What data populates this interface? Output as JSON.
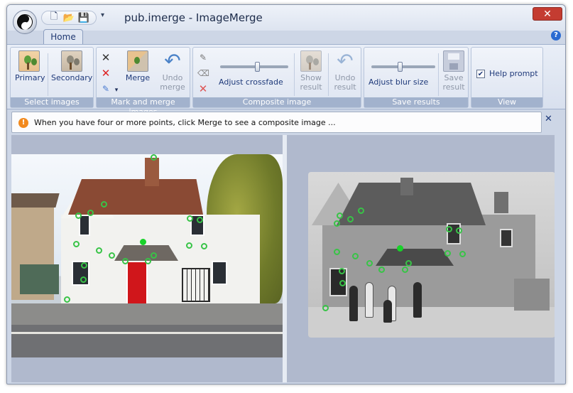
{
  "window": {
    "title": "pub.imerge - ImageMerge",
    "close_label": "✕"
  },
  "qat": {
    "icons": [
      "new-document-icon",
      "open-folder-icon",
      "save-disk-icon"
    ],
    "customize_label": "▾"
  },
  "tabs": [
    {
      "label": "Home",
      "selected": true
    }
  ],
  "help_label": "?",
  "ribbon": {
    "groups": [
      {
        "label": "Select images"
      },
      {
        "label": "Mark and merge images"
      },
      {
        "label": "Composite image"
      },
      {
        "label": "Save results"
      },
      {
        "label": "View"
      }
    ],
    "select_images": {
      "primary_label": "Primary",
      "secondary_label": "Secondary"
    },
    "mark_merge": {
      "merge_label": "Merge",
      "undo_merge_label": "Undo merge",
      "undo_merge_enabled": false
    },
    "composite": {
      "crossfade_label": "Adjust crossfade",
      "crossfade_value": 0.55,
      "show_result_label": "Show result",
      "show_result_enabled": false,
      "undo_result_label": "Undo result",
      "undo_result_enabled": false
    },
    "save_results": {
      "blur_label": "Adjust blur size",
      "blur_value": 0.45,
      "save_result_label": "Save result",
      "save_result_enabled": false
    },
    "view": {
      "help_prompt_label": "Help prompt",
      "help_prompt_checked": true
    }
  },
  "notification": {
    "text": "When you have four or more points, click Merge to see a composite image ...",
    "close_label": "✕"
  },
  "colors": {
    "accent": "#1f3a7a",
    "marker": "#38c447",
    "close": "#c43c31",
    "info": "#f28a1f"
  }
}
